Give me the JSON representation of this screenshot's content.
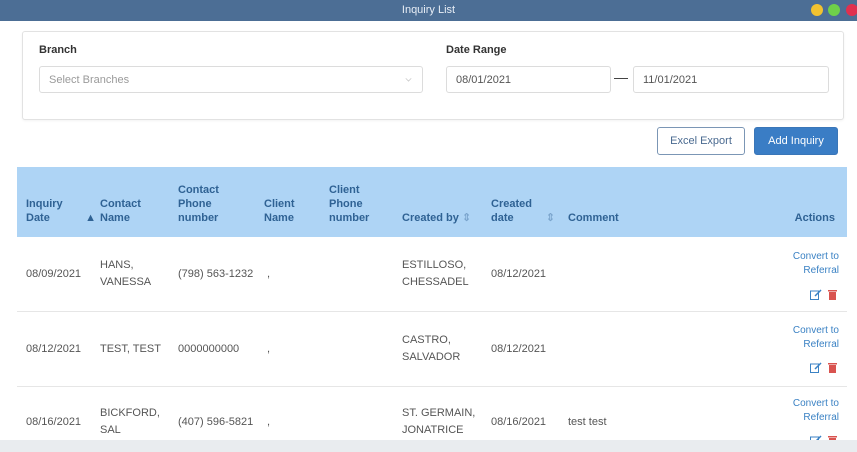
{
  "window": {
    "title": "Inquiry List"
  },
  "filters": {
    "branch_label": "Branch",
    "branch_placeholder": "Select Branches",
    "date_range_label": "Date Range",
    "date_from": "08/01/2021",
    "date_to": "11/01/2021"
  },
  "toolbar": {
    "excel_export_label": "Excel Export",
    "add_inquiry_label": "Add Inquiry"
  },
  "table": {
    "columns": {
      "inquiry_date": "Inquiry Date",
      "contact_name": "Contact Name",
      "contact_phone": "Contact Phone number",
      "client_name": "Client Name",
      "client_phone": "Client Phone number",
      "created_by": "Created by",
      "created_date": "Created date",
      "comment": "Comment",
      "actions": "Actions"
    },
    "rows": [
      {
        "inquiry_date": "08/09/2021",
        "contact_name": "HANS, VANESSA",
        "contact_phone": "(798) 563-1232",
        "client_name": ",",
        "client_phone": "",
        "created_by": "ESTILLOSO, CHESSADEL",
        "created_date": "08/12/2021",
        "comment": "",
        "convert_label": "Convert to Referral"
      },
      {
        "inquiry_date": "08/12/2021",
        "contact_name": "TEST, TEST",
        "contact_phone": "0000000000",
        "client_name": ",",
        "client_phone": "",
        "created_by": "CASTRO, SALVADOR",
        "created_date": "08/12/2021",
        "comment": "",
        "convert_label": "Convert to Referral"
      },
      {
        "inquiry_date": "08/16/2021",
        "contact_name": "BICKFORD, SAL",
        "contact_phone": "(407) 596-5821",
        "client_name": ",",
        "client_phone": "",
        "created_by": "ST. GERMAIN, JONATRICE",
        "created_date": "08/16/2021",
        "comment": "test test",
        "convert_label": "Convert to Referral"
      }
    ]
  },
  "colors": {
    "titlebar": "#4c6e95",
    "header_bg": "#aed4f5",
    "header_text": "#2f6294",
    "primary": "#3a7dc5",
    "delete": "#d9534f"
  }
}
